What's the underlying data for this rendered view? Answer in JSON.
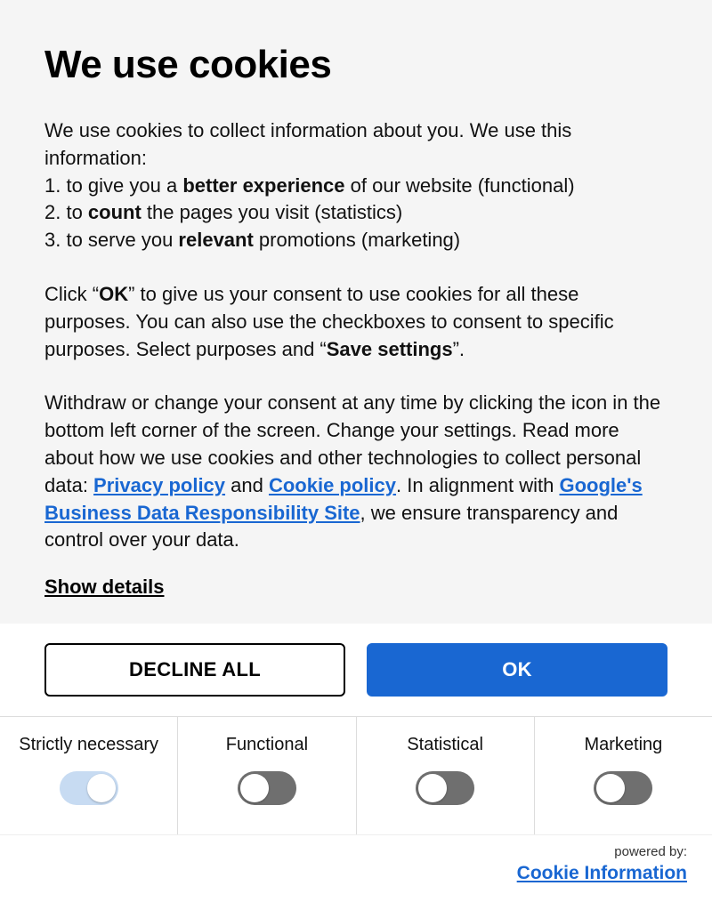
{
  "title": "We use cookies",
  "intro": {
    "lead": "We use cookies to collect information about you. We use this information:",
    "item1_a": "1. to give you a ",
    "item1_b": "better experience",
    "item1_c": " of our website (functional)",
    "item2_a": "2. to ",
    "item2_b": "count",
    "item2_c": " the pages you visit (statistics)",
    "item3_a": "3. to serve you ",
    "item3_b": "relevant",
    "item3_c": " promotions (marketing)"
  },
  "consent": {
    "a": "Click “",
    "b": "OK",
    "c": "” to give us your consent to use cookies for all these purposes. You can also use the checkboxes to consent to specific purposes. Select purposes and “",
    "d": "Save settings",
    "e": "”."
  },
  "withdraw": {
    "a": "Withdraw or change your consent at any time by clicking the icon in the bottom left corner of the screen. Change your settings. Read more about how we use cookies and other technologies to collect personal data: ",
    "privacy": "Privacy policy",
    "and": " and ",
    "cookie": "Cookie policy",
    "b": ". In alignment with ",
    "google": "Google's Business Data Responsibility Site",
    "c": ", we ensure transparency and control over your data."
  },
  "show_details": "Show details",
  "buttons": {
    "decline": "DECLINE ALL",
    "ok": "OK"
  },
  "categories": {
    "necessary": "Strictly necessary",
    "functional": "Functional",
    "statistical": "Statistical",
    "marketing": "Marketing"
  },
  "footer": {
    "powered_by": "powered by:",
    "brand": "Cookie Information"
  }
}
